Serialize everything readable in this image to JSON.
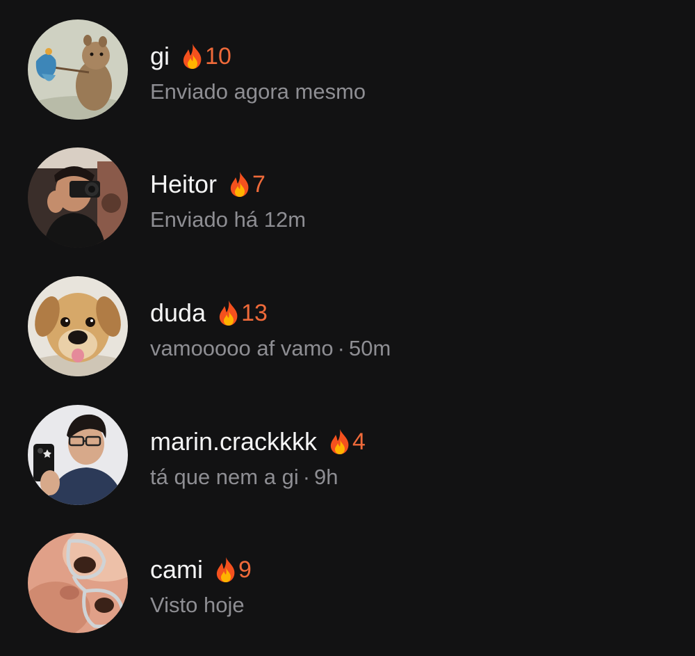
{
  "chats": [
    {
      "name": "gi",
      "streak": "10",
      "status": "Enviado agora mesmo",
      "time": "",
      "avatar_icon": "hamster-photo",
      "streak_icon": "fire-emoji"
    },
    {
      "name": "Heitor",
      "streak": "7",
      "status": "Enviado há 12m",
      "time": "",
      "avatar_icon": "camera-person-photo",
      "streak_icon": "fire-emoji"
    },
    {
      "name": "duda",
      "streak": "13",
      "status": "vamooooo af vamo",
      "time": "50m",
      "avatar_icon": "puppy-photo",
      "streak_icon": "fire-emoji"
    },
    {
      "name": "marin.crackkkk",
      "streak": "4",
      "status": "tá que nem a gi",
      "time": "9h",
      "avatar_icon": "mirror-selfie-photo",
      "streak_icon": "fire-emoji"
    },
    {
      "name": "cami",
      "streak": "9",
      "status": "Visto hoje",
      "time": "",
      "avatar_icon": "closeup-glasses-photo",
      "streak_icon": "fire-emoji"
    }
  ],
  "colors": {
    "background": "#121213",
    "name": "#f5f5f5",
    "streak": "#ef6a3a",
    "secondary": "#8e8e93"
  }
}
